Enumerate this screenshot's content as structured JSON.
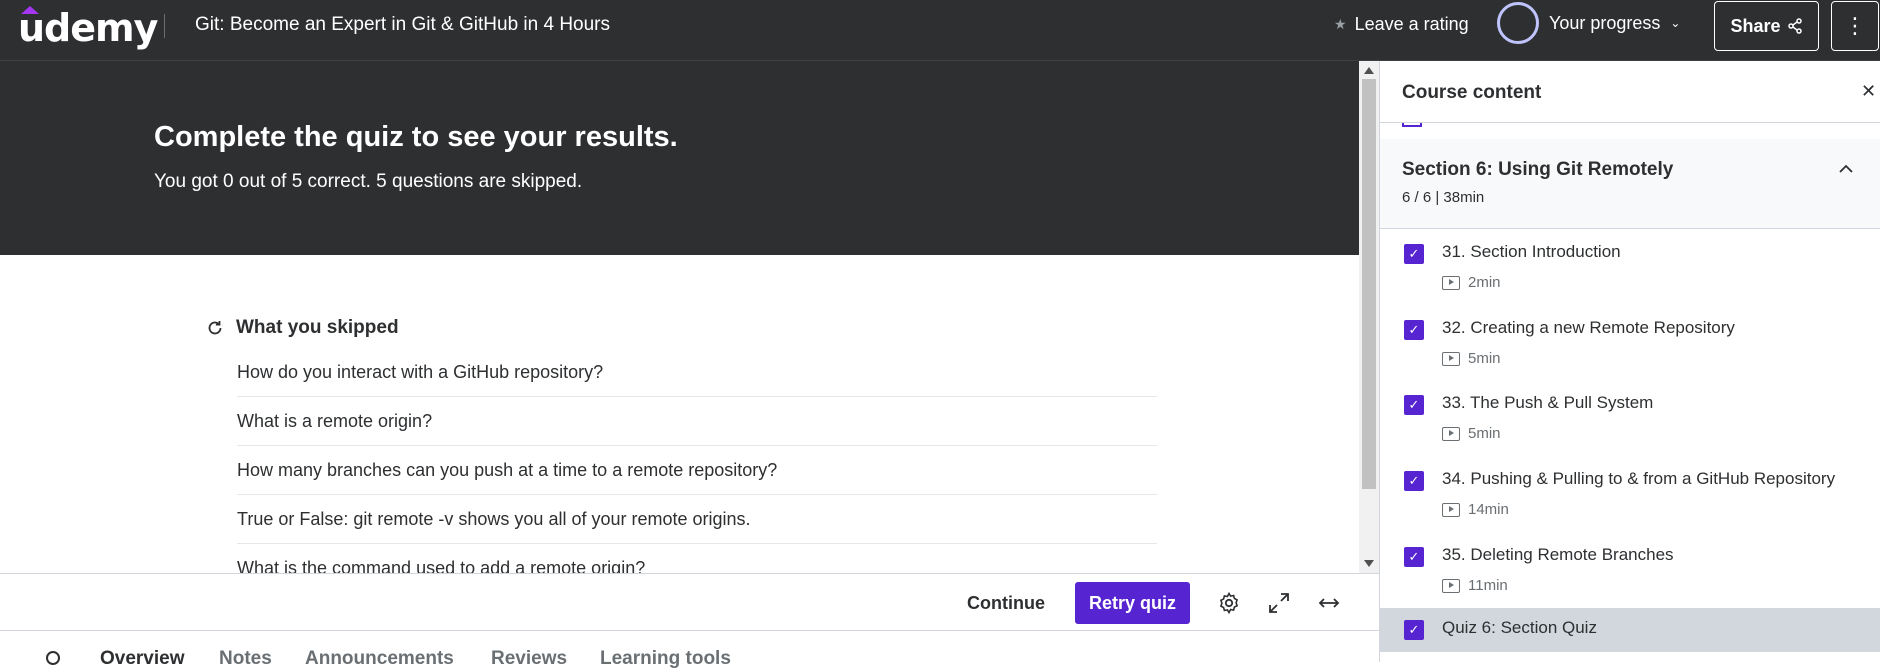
{
  "header": {
    "logo": "udemy",
    "course_title": "Git: Become an Expert in Git & GitHub in 4 Hours",
    "rating_label": "Leave a rating",
    "progress_label": "Your progress",
    "share_label": "Share"
  },
  "quiz": {
    "title": "Complete the quiz to see your results.",
    "summary": "You got 0 out of 5 correct. 5 questions are skipped.",
    "skipped_heading": "What you skipped",
    "skipped_questions": [
      "How do you interact with a GitHub repository?",
      "What is a remote origin?",
      "How many branches can you push at a time to a remote repository?",
      "True or False: git remote -v shows you all of your remote origins.",
      "What is the command used to add a remote origin?"
    ]
  },
  "controls": {
    "continue_label": "Continue",
    "retry_label": "Retry quiz"
  },
  "tabs": [
    "Overview",
    "Notes",
    "Announcements",
    "Reviews",
    "Learning tools"
  ],
  "sidebar": {
    "title": "Course content",
    "section": {
      "title": "Section 6: Using Git Remotely",
      "meta": "6 / 6 | 38min"
    },
    "lectures": [
      {
        "title": "31. Section Introduction",
        "duration": "2min"
      },
      {
        "title": "32. Creating a new Remote Repository",
        "duration": "5min"
      },
      {
        "title": "33. The Push & Pull System",
        "duration": "5min"
      },
      {
        "title": "34. Pushing & Pulling to & from a GitHub Repository",
        "duration": "14min"
      },
      {
        "title": "35. Deleting Remote Branches",
        "duration": "11min"
      },
      {
        "title": "Quiz 6: Section Quiz",
        "duration": ""
      }
    ]
  },
  "colors": {
    "accent": "#5624d0",
    "dark_bg": "#2d2f31"
  }
}
